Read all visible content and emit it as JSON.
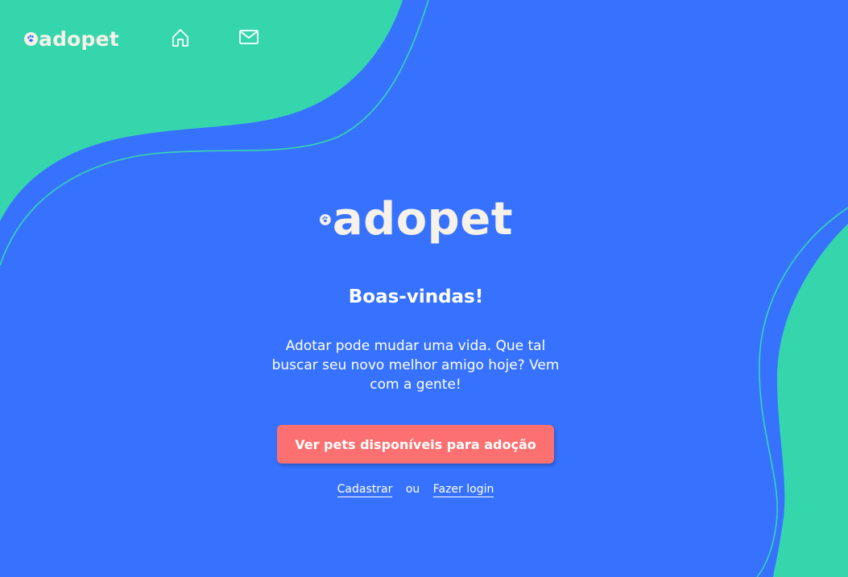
{
  "brand": {
    "logo_text": "adopet"
  },
  "nav": {
    "items": [
      {
        "icon": "home-icon"
      },
      {
        "icon": "mail-icon"
      }
    ]
  },
  "hero": {
    "logo_text": "adopet",
    "title": "Boas-vindas!",
    "description": "Adotar pode mudar uma vida. Que tal buscar seu novo melhor amigo hoje? Vem com a gente!",
    "cta_label": "Ver pets disponíveis para adoção",
    "signup_label": "Cadastrar",
    "separator": "ou",
    "login_label": "Fazer login"
  },
  "colors": {
    "background_blue": "#3772FF",
    "accent_green": "#36D6AD",
    "cta_coral": "#FC7071",
    "logo_cream": "#F6F1E9"
  }
}
